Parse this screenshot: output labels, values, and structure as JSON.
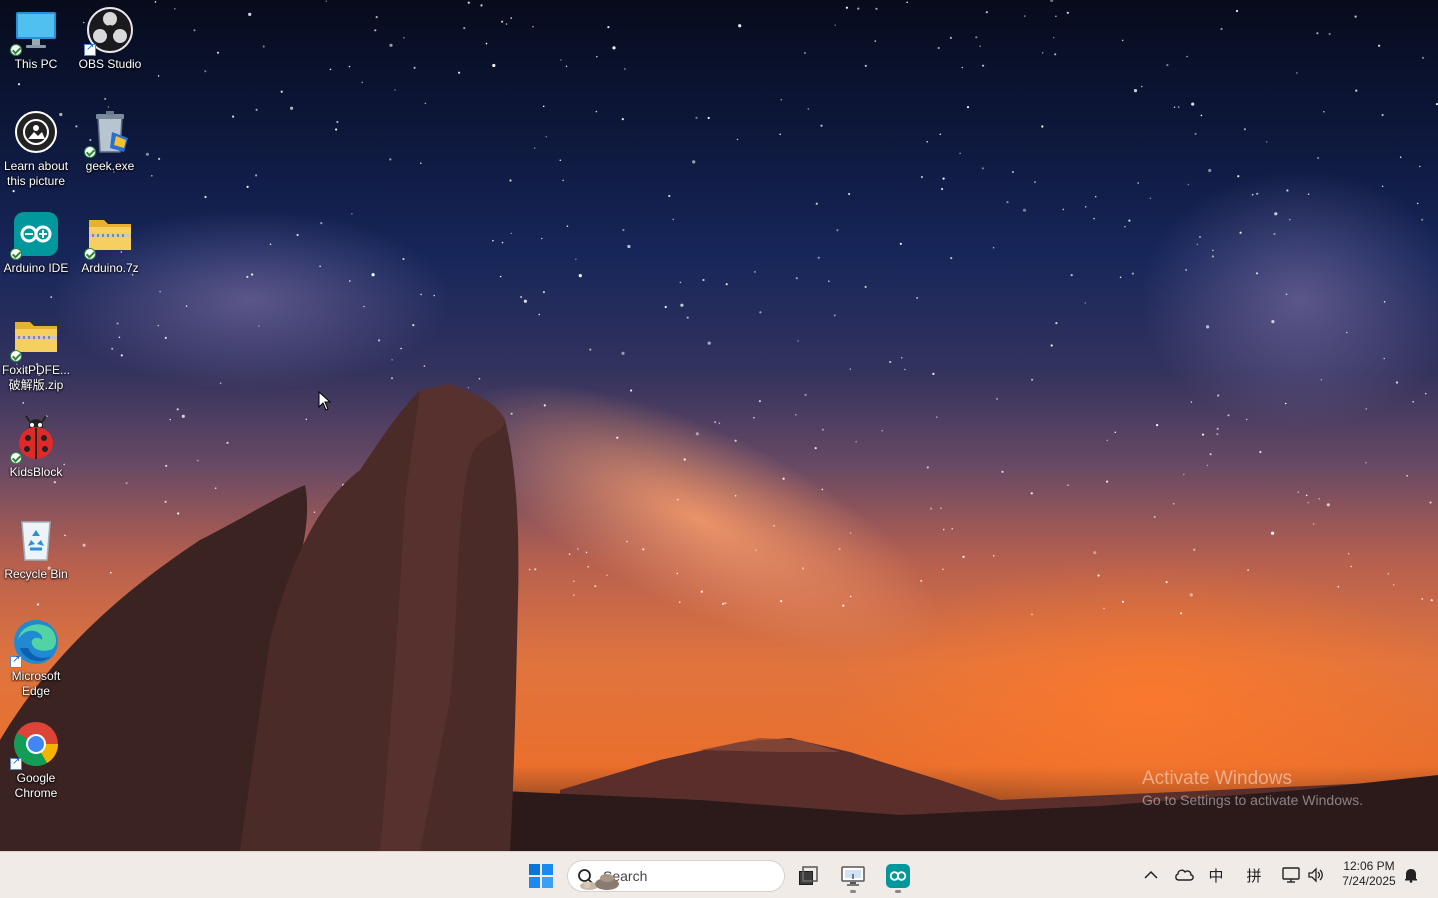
{
  "desktop": {
    "icons": [
      {
        "label": "This PC",
        "icon": "computer-icon",
        "badge": "sync"
      },
      {
        "label": "OBS Studio",
        "icon": "obs-studio-icon",
        "badge": "shortcut"
      },
      {
        "label": "Learn about this picture",
        "icon": "learn-about-picture-icon",
        "badge": "none"
      },
      {
        "label": "geek.exe",
        "icon": "geek-exe-icon",
        "badge": "sync"
      },
      {
        "label": "Arduino IDE",
        "icon": "arduino-ide-icon",
        "badge": "sync"
      },
      {
        "label": "Arduino.7z",
        "icon": "zip-folder-icon",
        "badge": "sync"
      },
      {
        "label": "FoxitPDFE... 破解版.zip",
        "icon": "zip-folder-icon",
        "badge": "sync"
      },
      {
        "label": "KidsBlock",
        "icon": "kidsblock-ladybug-icon",
        "badge": "sync"
      },
      {
        "label": "Recycle Bin",
        "icon": "recycle-bin-icon",
        "badge": "none"
      },
      {
        "label": "Microsoft Edge",
        "icon": "edge-icon",
        "badge": "shortcut"
      },
      {
        "label": "Google Chrome",
        "icon": "chrome-icon",
        "badge": "shortcut"
      }
    ]
  },
  "watermark": {
    "title": "Activate Windows",
    "subtitle": "Go to Settings to activate Windows."
  },
  "taskbar": {
    "start_icon": "windows-start-icon",
    "search_placeholder": "Search",
    "apps": [
      {
        "name": "task-view",
        "icon": "task-view-icon",
        "running": false
      },
      {
        "name": "remote-desktop",
        "icon": "remote-desktop-icon",
        "running": true
      },
      {
        "name": "arduino-ide",
        "icon": "arduino-ide-icon",
        "running": true
      }
    ],
    "tray": {
      "overflow_icon": "chevron-up-icon",
      "onedrive_icon": "cloud-icon",
      "ime_mode": "中",
      "ime_layout": "拼",
      "network_icon": "network-icon",
      "volume_icon": "speaker-icon",
      "time": "12:06 PM",
      "date": "7/24/2025",
      "notification_icon": "bell-icon"
    }
  },
  "colors": {
    "taskbar_bg": "#f1ebe8",
    "arduino_teal": "#00979d",
    "win_blue": "#0078d4",
    "folder_yellow": "#f5c542"
  }
}
